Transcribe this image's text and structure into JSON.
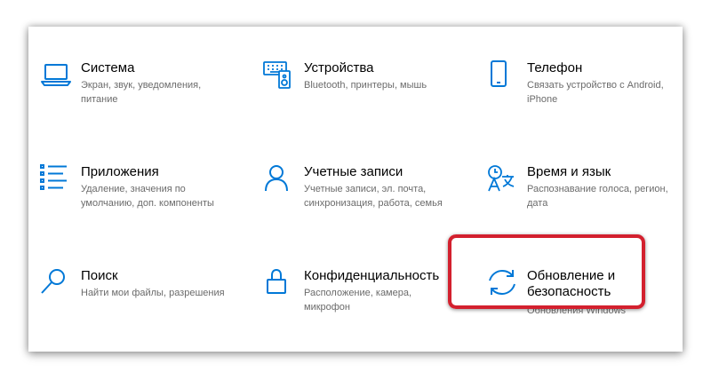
{
  "accent": "#0078d7",
  "highlight_color": "#d3202e",
  "tiles": [
    {
      "id": "system",
      "icon": "laptop-icon",
      "title": "Система",
      "desc": "Экран, звук, уведомления, питание"
    },
    {
      "id": "devices",
      "icon": "keyboard-speaker-icon",
      "title": "Устройства",
      "desc": "Bluetooth, принтеры, мышь"
    },
    {
      "id": "phone",
      "icon": "phone-icon",
      "title": "Телефон",
      "desc": "Связать устройство с Android, iPhone"
    },
    {
      "id": "apps",
      "icon": "apps-list-icon",
      "title": "Приложения",
      "desc": "Удаление, значения по умолчанию, доп. компоненты"
    },
    {
      "id": "accounts",
      "icon": "person-icon",
      "title": "Учетные записи",
      "desc": "Учетные записи, эл. почта, синхронизация, работа, семья"
    },
    {
      "id": "time-language",
      "icon": "time-language-icon",
      "title": "Время и язык",
      "desc": "Распознавание голоса, регион, дата"
    },
    {
      "id": "search",
      "icon": "search-icon",
      "title": "Поиск",
      "desc": "Найти мои файлы, разрешения"
    },
    {
      "id": "privacy",
      "icon": "lock-icon",
      "title": "Конфиденциальность",
      "desc": "Расположение, камера, микрофон"
    },
    {
      "id": "update-security",
      "icon": "sync-arrows-icon",
      "title": "Обновление и безопасность",
      "desc": "Обновления Windows"
    }
  ]
}
